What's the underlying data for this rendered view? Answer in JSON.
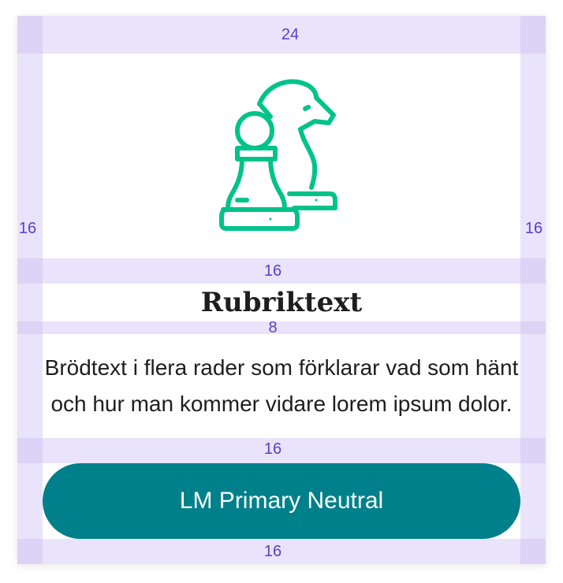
{
  "spacing_labels": {
    "top": "24",
    "left": "16",
    "right": "16",
    "after_icon": "16",
    "after_title": "8",
    "after_body": "16",
    "bottom": "16"
  },
  "content": {
    "icon": "chess-pawn-knight-icon",
    "title": "Rubriktext",
    "body": "Brödtext i flera rader som förklarar vad som hänt och hur man kommer vidare lorem ipsum dolor."
  },
  "button": {
    "label": "LM Primary Neutral"
  },
  "colors": {
    "icon": "#00c389",
    "button_bg": "#00808b",
    "spacer": "#e9e3fb",
    "spacer_label": "#5a3fc8"
  }
}
